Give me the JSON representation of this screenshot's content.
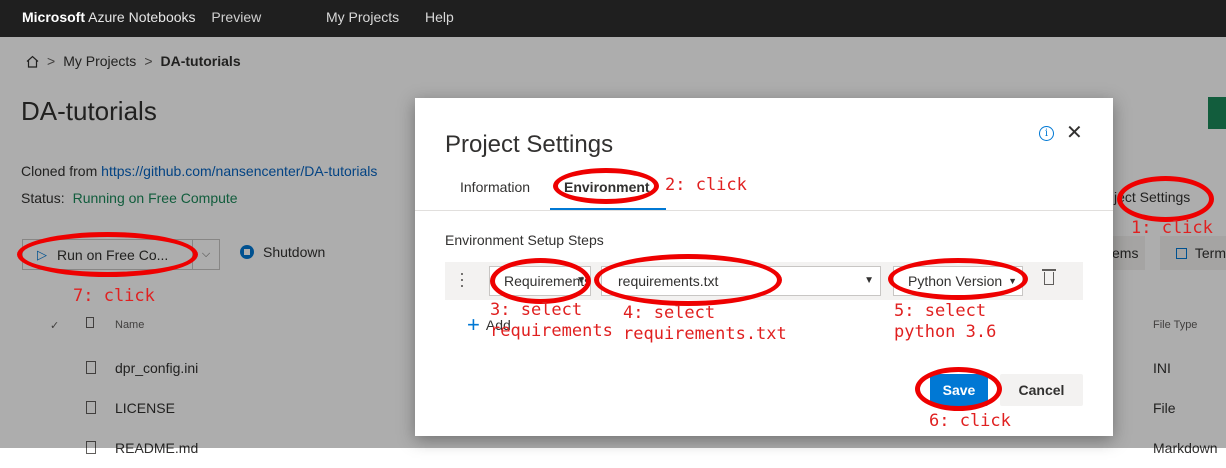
{
  "topbar": {
    "brand_bold": "Microsoft",
    "brand_rest": "Azure Notebooks",
    "preview": "Preview",
    "nav": [
      "My Projects",
      "Help"
    ]
  },
  "breadcrumb": {
    "home_icon": "home-icon",
    "items": [
      "My Projects",
      "DA-tutorials"
    ],
    "separator": ">"
  },
  "project": {
    "title": "DA-tutorials",
    "cloned_label": "Cloned from",
    "cloned_url": "https://github.com/nansencenter/DA-tutorials",
    "status_label": "Status:",
    "status_value": "Running on Free Compute"
  },
  "toolbar": {
    "run_label": "Run on Free Co...",
    "shutdown_label": "Shutdown",
    "project_settings_partial": "ject Settings",
    "items_partial": "ems",
    "terminal_partial": "Term"
  },
  "files": {
    "headers": {
      "check": "✓",
      "name": "Name",
      "type": "File Type"
    },
    "rows": [
      {
        "name": "dpr_config.ini",
        "type": "INI"
      },
      {
        "name": "LICENSE",
        "type": "File"
      },
      {
        "name": "README.md",
        "type": "Markdown"
      }
    ]
  },
  "modal": {
    "title": "Project Settings",
    "tabs": [
      "Information",
      "Environment"
    ],
    "active_tab": "Environment",
    "section_heading": "Environment Setup Steps",
    "step": {
      "type_value": "Requirements",
      "file_value": "requirements.txt",
      "version_value": "Python Version"
    },
    "add_label": "Add",
    "save_label": "Save",
    "cancel_label": "Cancel"
  },
  "annotations": {
    "a1": "1: click",
    "a2": "2: click",
    "a3": "3: select\nrequirements",
    "a4": "4: select\nrequirements.txt",
    "a5": "5: select\npython 3.6",
    "a6": "6: click",
    "a7": "7: click"
  },
  "colors": {
    "accent": "#0078d4",
    "annotation": "#ee0000",
    "topbar": "#1f1f1f",
    "status_green": "#1b8a5a"
  }
}
